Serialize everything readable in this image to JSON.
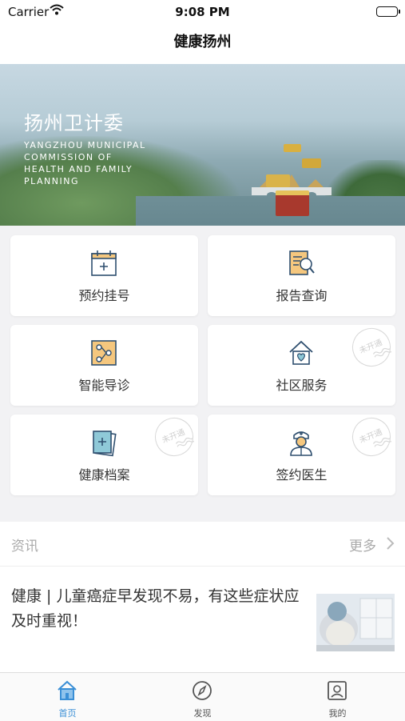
{
  "status_bar": {
    "carrier": "Carrier",
    "time": "9:08 PM"
  },
  "nav": {
    "title": "健康扬州"
  },
  "banner": {
    "title": "扬州卫计委",
    "subtitle_lines": [
      "YANGZHOU MUNICIPAL",
      "COMMISSION OF",
      "HEALTH AND FAMILY",
      "PLANNING"
    ]
  },
  "services": [
    {
      "label": "预约挂号",
      "icon": "calendar-plus-icon",
      "stamp": ""
    },
    {
      "label": "报告查询",
      "icon": "report-search-icon",
      "stamp": ""
    },
    {
      "label": "智能导诊",
      "icon": "smart-guide-icon",
      "stamp": ""
    },
    {
      "label": "社区服务",
      "icon": "community-home-icon",
      "stamp": "未开通"
    },
    {
      "label": "健康档案",
      "icon": "health-record-icon",
      "stamp": "未开通"
    },
    {
      "label": "签约医生",
      "icon": "doctor-icon",
      "stamp": "未开通"
    }
  ],
  "news": {
    "section_title": "资讯",
    "more_label": "更多",
    "items": [
      {
        "title": "健康 | 儿童癌症早发现不易，有这些症状应及时重视！"
      }
    ]
  },
  "tabs": [
    {
      "label": "首页",
      "icon": "home-icon",
      "active": true
    },
    {
      "label": "发现",
      "icon": "compass-icon",
      "active": false
    },
    {
      "label": "我的",
      "icon": "profile-icon",
      "active": false
    }
  ],
  "colors": {
    "accent": "#3a8fd6",
    "icon_fill": "#f5c77e",
    "icon_stroke": "#2f4f6f"
  }
}
